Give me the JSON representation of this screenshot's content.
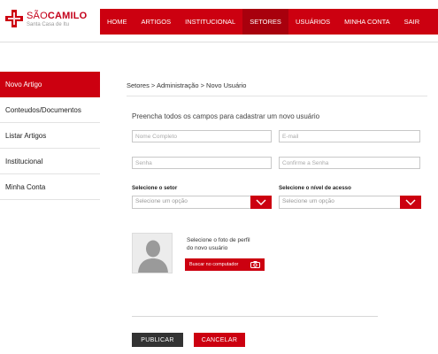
{
  "brand": {
    "name_light": "SÃO",
    "name_bold": "CAMILO",
    "subtitle": "Santa Casa de Itu"
  },
  "nav": {
    "items": [
      {
        "label": "HOME"
      },
      {
        "label": "ARTIGOS"
      },
      {
        "label": "INSTITUCIONAL"
      },
      {
        "label": "SETORES"
      },
      {
        "label": "USUÁRIOS"
      },
      {
        "label": "MINHA CONTA"
      },
      {
        "label": "SAIR"
      }
    ],
    "active": "SETORES"
  },
  "sidebar": {
    "items": [
      {
        "label": "Novo Artigo"
      },
      {
        "label": "Conteudos/Documentos"
      },
      {
        "label": "Listar Artigos"
      },
      {
        "label": "Institucional"
      },
      {
        "label": "Minha Conta"
      }
    ],
    "active": "Novo Artigo"
  },
  "breadcrumb": "Setores > Administração > Novo Usuário",
  "form": {
    "title": "Preencha todos os campos para cadastrar um novo usuário",
    "fields": {
      "nome": {
        "placeholder": "Nome Completo",
        "value": ""
      },
      "email": {
        "placeholder": "E-mail",
        "value": ""
      },
      "senha": {
        "placeholder": "Senha",
        "value": ""
      },
      "confirma": {
        "placeholder": "Confirme a Senha",
        "value": ""
      }
    },
    "setor": {
      "label": "Selecione o setor",
      "selected": "Selecione um opção"
    },
    "acesso": {
      "label": "Selecione o nível de acesso",
      "selected": "Selecione um opção"
    },
    "photo": {
      "line1": "Selecione o foto de perfil",
      "line2": "do novo usuário",
      "button": "Buscar no computador"
    },
    "publish_label": "PUBLICAR",
    "cancel_label": "CANCELAR"
  },
  "colors": {
    "brand_red": "#cc0010",
    "dark_button": "#333333"
  },
  "icons": [
    "sao-camilo-cross-logo",
    "chevron-down-icon",
    "user-silhouette-icon",
    "camera-icon"
  ]
}
